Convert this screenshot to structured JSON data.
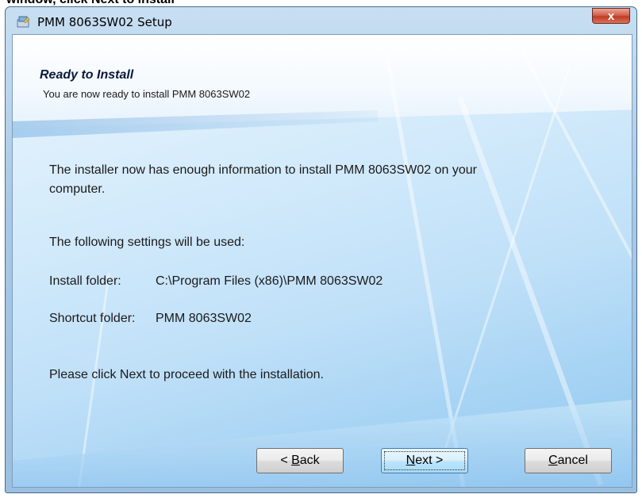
{
  "top_crop_text": "window, click Next to install",
  "window": {
    "title": "PMM 8063SW02 Setup",
    "close_label": "x"
  },
  "header": {
    "title": "Ready to Install",
    "subtitle": "You are now ready to install PMM 8063SW02"
  },
  "body": {
    "info_line1": "The installer now has enough information to install PMM 8063SW02 on your",
    "info_line2": "computer.",
    "settings_intro": "The following settings will be used:",
    "install_folder_label": "Install folder:",
    "install_folder_value": "C:\\Program Files (x86)\\PMM 8063SW02",
    "shortcut_folder_label": "Shortcut folder:",
    "shortcut_folder_value": "PMM 8063SW02",
    "proceed_text": "Please click Next to proceed with the installation."
  },
  "buttons": {
    "back_prefix": "< ",
    "back_mnemonic": "B",
    "back_rest": "ack",
    "next_mnemonic": "N",
    "next_rest": "ext >",
    "cancel_mnemonic": "C",
    "cancel_rest": "ancel"
  },
  "colors": {
    "close_button": "#c13a24",
    "default_button_border": "#3c7fb1"
  },
  "icons": {
    "app": "installer-app-icon",
    "close": "close-icon"
  }
}
